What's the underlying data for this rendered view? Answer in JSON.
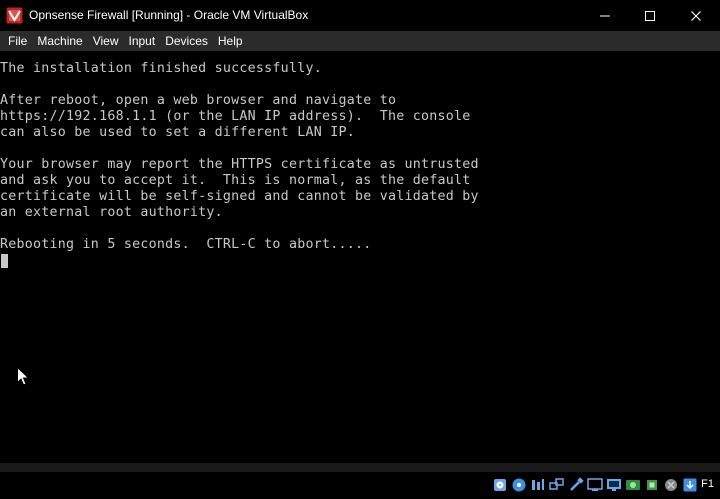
{
  "window": {
    "title": "Opnsense Firewall [Running] - Oracle VM VirtualBox",
    "app_icon": "virtualbox-icon",
    "controls": [
      "minimize-icon",
      "maximize-icon",
      "close-icon"
    ]
  },
  "menubar": {
    "items": [
      "File",
      "Machine",
      "View",
      "Input",
      "Devices",
      "Help"
    ]
  },
  "console": {
    "lines": [
      "The installation finished successfully.",
      "",
      "After reboot, open a web browser and navigate to",
      "https://192.168.1.1 (or the LAN IP address).  The console",
      "can also be used to set a different LAN IP.",
      "",
      "Your browser may report the HTTPS certificate as untrusted",
      "and ask you to accept it.  This is normal, as the default",
      "certificate will be self-signed and cannot be validated by",
      "an external root authority.",
      "",
      "Rebooting in 5 seconds.  CTRL-C to abort....."
    ],
    "text_color": "#c8c8c8"
  },
  "statusbar": {
    "icons": [
      "hard-disk-icon",
      "optical-drive-icon",
      "audio-icon",
      "network-icon",
      "usb-icon",
      "shared-folders-icon",
      "display-icon",
      "video-capture-icon",
      "cpu-icon",
      "mouse-integration-icon",
      "keyboard-capture-icon"
    ],
    "host_key": "F1"
  }
}
